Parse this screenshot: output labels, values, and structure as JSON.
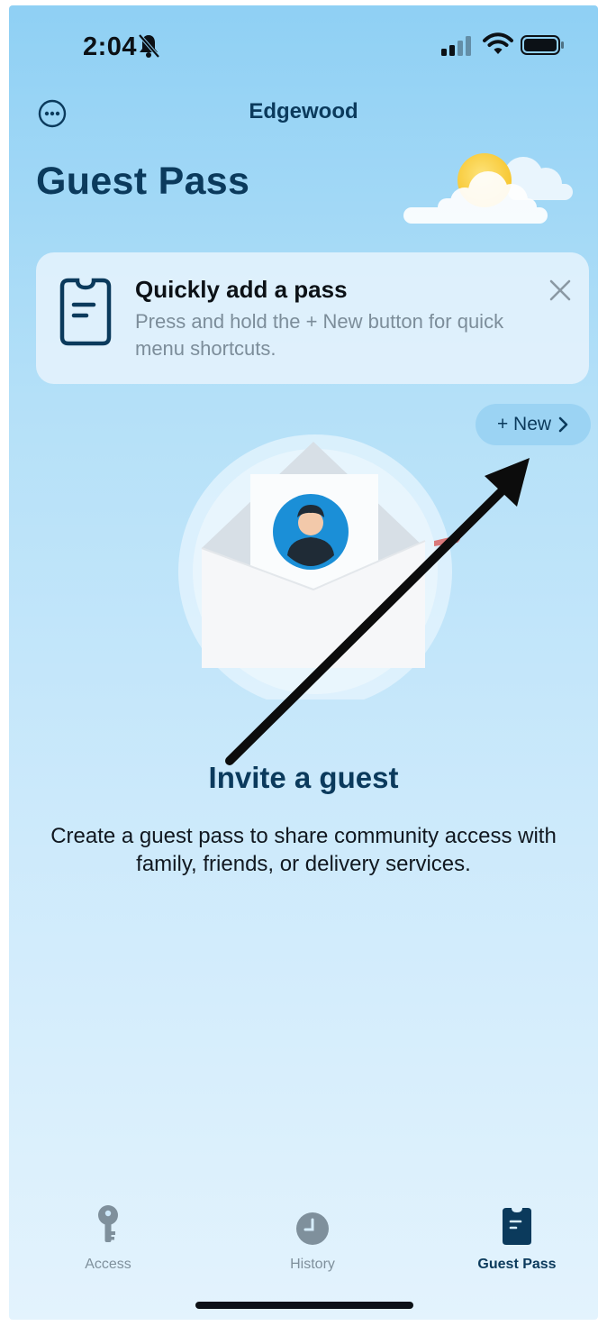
{
  "status_bar": {
    "time": "2:04"
  },
  "header": {
    "community": "Edgewood",
    "title": "Guest Pass"
  },
  "tip_card": {
    "title": "Quickly add a pass",
    "body": "Press and hold the + New button for quick menu shortcuts."
  },
  "new_button": {
    "label": "+ New"
  },
  "empty_state": {
    "title": "Invite a guest",
    "body": "Create a guest pass to share community access with family, friends, or delivery services."
  },
  "tabs": [
    {
      "label": "Access",
      "icon": "key-icon",
      "active": false
    },
    {
      "label": "History",
      "icon": "clock-icon",
      "active": false
    },
    {
      "label": "Guest Pass",
      "icon": "pass-icon",
      "active": true
    }
  ],
  "colors": {
    "primary": "#0b3a5c",
    "inactive": "#7f909c",
    "accent": "#1e8fd6",
    "button_bg": "#9bd3f3"
  }
}
